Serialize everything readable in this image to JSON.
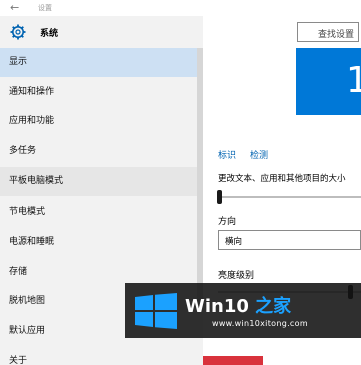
{
  "window": {
    "title": "设置"
  },
  "sidebar": {
    "section_title": "系统",
    "items": [
      {
        "label": "显示"
      },
      {
        "label": "通知和操作"
      },
      {
        "label": "应用和功能"
      },
      {
        "label": "多任务"
      },
      {
        "label": "平板电脑模式"
      },
      {
        "label": "节电模式"
      },
      {
        "label": "电源和睡眠"
      },
      {
        "label": "存储"
      },
      {
        "label": "脱机地图"
      },
      {
        "label": "默认应用"
      },
      {
        "label": "关于"
      }
    ]
  },
  "main": {
    "search_label": "查找设置",
    "monitor_number": "1",
    "identify_link": "标识",
    "detect_link": "检测",
    "scale_label": "更改文本、应用和其他项目的大小",
    "scale_value": 0.0,
    "orientation_label": "方向",
    "orientation_value": "横向",
    "brightness_label": "亮度级别",
    "brightness_value": 0.95
  },
  "watermark": {
    "brand_prefix": "Win10",
    "brand_suffix": "之家",
    "url": "www.win10xitong.com"
  },
  "colors": {
    "accent": "#0078d7",
    "selected_bg": "#cde0f3",
    "watermark_accent": "#1ba1ff"
  }
}
